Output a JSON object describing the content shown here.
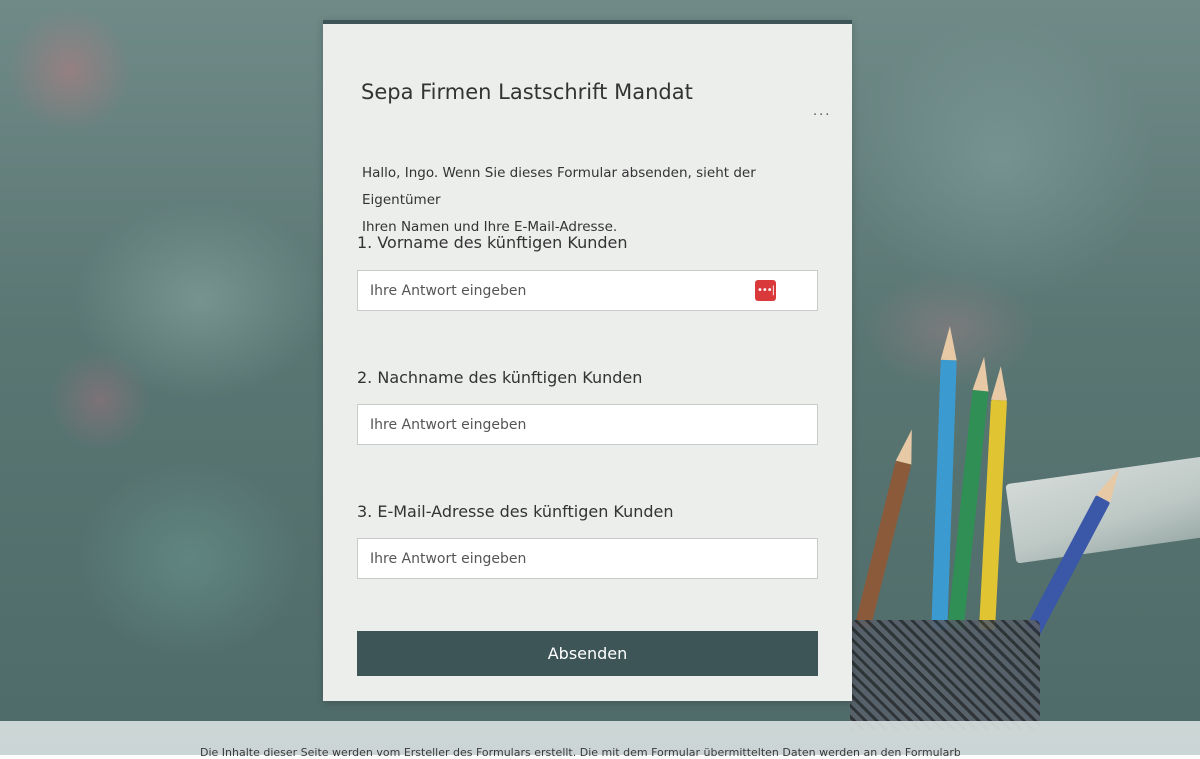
{
  "form": {
    "title": "Sepa Firmen Lastschrift Mandat",
    "more_label": "...",
    "intro_line1": "Hallo, Ingo. Wenn Sie dieses Formular absenden, sieht der Eigentümer",
    "intro_line2": "Ihren Namen und Ihre E-Mail-Adresse.",
    "questions": [
      {
        "label": "1. Vorname des künftigen Kunden",
        "placeholder": "Ihre Antwort eingeben",
        "value": ""
      },
      {
        "label": "2. Nachname des künftigen Kunden",
        "placeholder": "Ihre Antwort eingeben",
        "value": ""
      },
      {
        "label": "3. E-Mail-Adresse des künftigen Kunden",
        "placeholder": "Ihre Antwort eingeben",
        "value": ""
      }
    ],
    "submit_label": "Absenden",
    "password_icon_glyph": "•••|"
  },
  "footer": {
    "text": "Die Inhalte dieser Seite werden vom Ersteller des Formulars erstellt. Die mit dem Formular übermittelten Daten werden an den Formularbesitzer gesendet."
  },
  "colors": {
    "accent": "#3e5557",
    "card_bg": "#eceeec",
    "password_icon": "#d9393a"
  }
}
